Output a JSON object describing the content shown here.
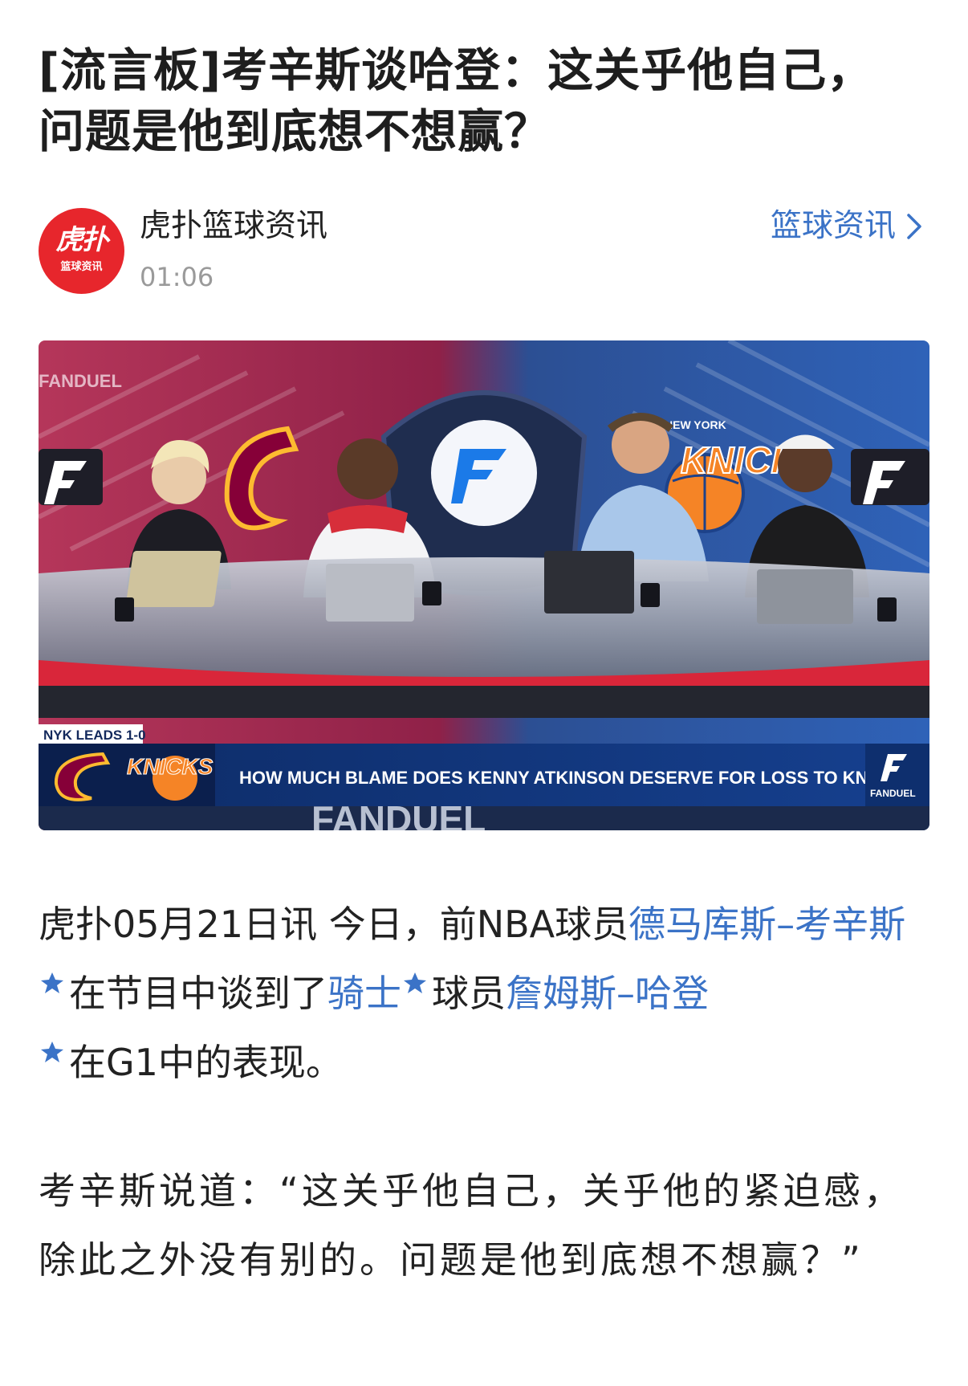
{
  "article": {
    "title_line1": "[流言板]考辛斯谈哈登：这关乎他自己，",
    "title_line2": "问题是他到底想不想赢？"
  },
  "author": {
    "avatar_text_top": "虎扑",
    "avatar_text_bottom": "篮球资讯",
    "name": "虎扑篮球资讯",
    "time": "01:06"
  },
  "channel": {
    "label": "篮球资讯",
    "icon": "chevron-right-icon"
  },
  "hero_image": {
    "brand_top": "FANDUEL",
    "knicks_script": "KNICKS",
    "knicks_arc": "NEW YORK",
    "series_badge": "NYK LEADS 1-0",
    "ticker_logo": "KNICKS",
    "headline": "HOW MUCH BLAME DOES KENNY ATKINSON DESERVE FOR LOSS TO KNICKS?",
    "ticker_brand": "FANDUEL",
    "floor_text": "FANDUEL"
  },
  "paragraph1": {
    "lead": "虎扑05月21日讯 今日，前NBA球员",
    "link1": "德马库斯–考辛斯",
    "mid1": "在节目中谈到了",
    "link2": "骑士",
    "mid2": "球员",
    "link3": "詹姆斯–哈登",
    "tail": "在G1中的表现。"
  },
  "paragraph2": {
    "text": "考辛斯说道：“这关乎他自己，关乎他的紧迫感，除此之外没有别的。问题是他到底想不想赢？”"
  },
  "colors": {
    "link": "#3b73c7",
    "avatar_bg": "#e7262c",
    "title": "#1e1e1e",
    "muted": "#9a9a9a"
  }
}
